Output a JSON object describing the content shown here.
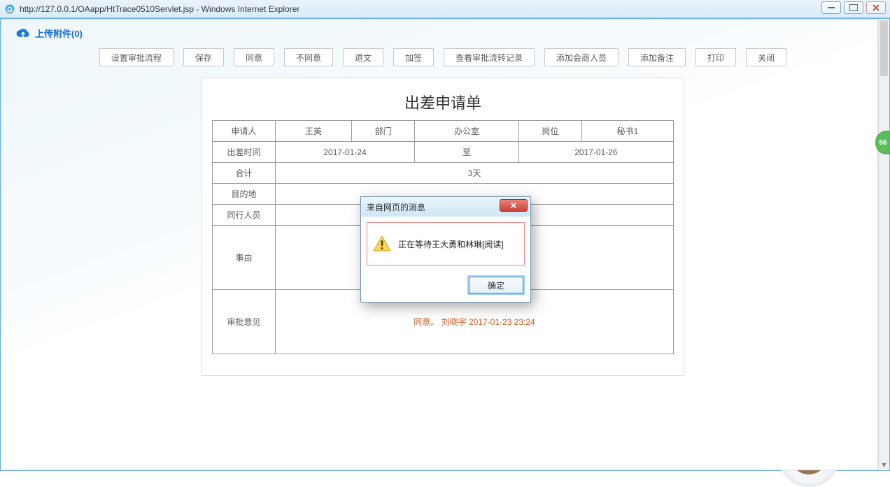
{
  "window": {
    "title": "http://127.0.0.1/OAapp/HtTrace0510Servlet.jsp - Windows Internet Explorer"
  },
  "upload": {
    "label": "上传附件(0)"
  },
  "toolbar": {
    "set_flow": "设置审批流程",
    "save": "保存",
    "agree": "同意",
    "disagree": "不同意",
    "return_doc": "退文",
    "add_sign": "加签",
    "view_flow": "查看审批流转记录",
    "add_consult": "添加会商人员",
    "add_note": "添加备注",
    "print": "打印",
    "close": "关闭"
  },
  "form": {
    "title": "出差申请单",
    "labels": {
      "applicant": "申请人",
      "dept": "部门",
      "post": "岗位",
      "trip_time": "出差时间",
      "to": "至",
      "total": "合计",
      "destination": "目的地",
      "companion": "同行人员",
      "reason": "事由",
      "approval": "审批意见"
    },
    "values": {
      "applicant": "王英",
      "dept": "办公室",
      "post": "秘书1",
      "start_date": "2017-01-24",
      "end_date": "2017-01-26",
      "total": "3天",
      "destination": "",
      "companion": "",
      "reason": "",
      "approval": "同意。 刘晓宇  2017-01-23  23:24"
    }
  },
  "alert": {
    "title": "来自网页的消息",
    "message": "正在等待王大勇和林琳[阅读]",
    "ok": "确定"
  },
  "side_badge": "56"
}
